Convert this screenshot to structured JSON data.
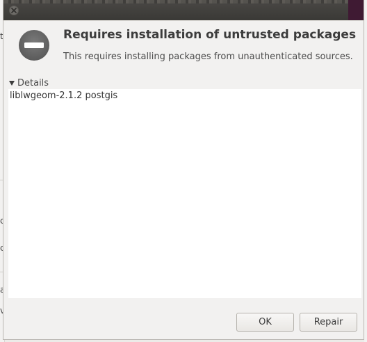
{
  "dialog": {
    "heading": "Requires installation of untrusted packages",
    "message": "This requires installing packages from unauthenticated sources.",
    "status_icon": "stop-icon"
  },
  "details": {
    "expander_label": "Details",
    "expanded": true,
    "items": [
      "liblwgeom-2.1.2 postgis"
    ]
  },
  "buttons": {
    "ok_label": "OK",
    "repair_label": "Repair"
  },
  "background_glyphs": [
    "t",
    "c",
    "c",
    "a",
    "v"
  ],
  "colors": {
    "titlebar": "#3c3b38",
    "plum_accent": "#3f1a33",
    "dialog_bg": "#f2f1f0",
    "details_bg": "#ffffff",
    "stop_icon_bg": "#6b6b6b"
  }
}
